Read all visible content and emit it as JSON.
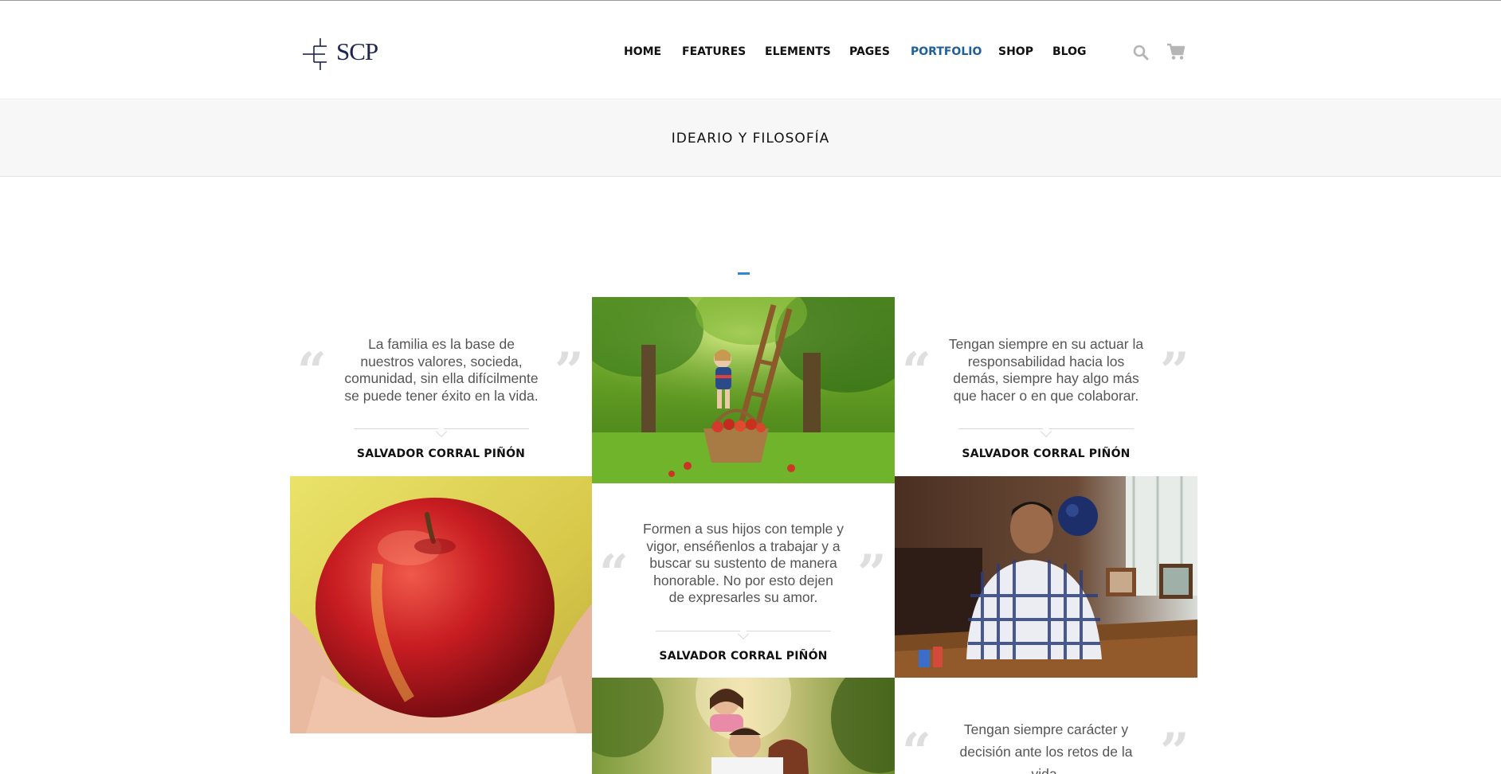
{
  "header": {
    "logo_text": "SCP",
    "nav": [
      {
        "label": "HOME",
        "active": false
      },
      {
        "label": "FEATURES",
        "active": false
      },
      {
        "label": "ELEMENTS",
        "active": false
      },
      {
        "label": "PAGES",
        "active": false
      },
      {
        "label": "PORTFOLIO",
        "active": true
      },
      {
        "label": "SHOP",
        "active": false
      },
      {
        "label": "BLOG",
        "active": false
      }
    ],
    "icons": [
      "search-icon",
      "cart-icon"
    ]
  },
  "page_title": "IDEARIO Y FILOSOFÍA",
  "colors": {
    "accent": "#2f87cf",
    "nav_active": "#1d5f9c",
    "quote_mark": "#dedede"
  },
  "quotes": [
    {
      "lines": [
        "La familia es la base de",
        "nuestros valores, socieda,",
        "comunidad, sin ella difícilmente",
        "se puede tener éxito en la vida."
      ],
      "author": "SALVADOR CORRAL PIÑÓN"
    },
    {
      "lines": [
        "Tengan siempre en su actuar la",
        "responsabilidad hacia los",
        "demás, siempre hay algo más",
        "que hacer o en que colaborar."
      ],
      "author": "SALVADOR CORRAL PIÑÓN"
    },
    {
      "lines": [
        "Formen a sus hijos con temple y",
        "vigor, enséñenlos a trabajar y a",
        "buscar su sustento de manera",
        "honorable. No por esto dejen",
        "de expresarles su amor."
      ],
      "author": "SALVADOR CORRAL PIÑÓN"
    },
    {
      "lines": [
        "Tengan siempre carácter y",
        "decisión ante los retos de la",
        "vida."
      ],
      "author": ""
    }
  ],
  "quote_marks": {
    "open": "“",
    "close": "”"
  }
}
